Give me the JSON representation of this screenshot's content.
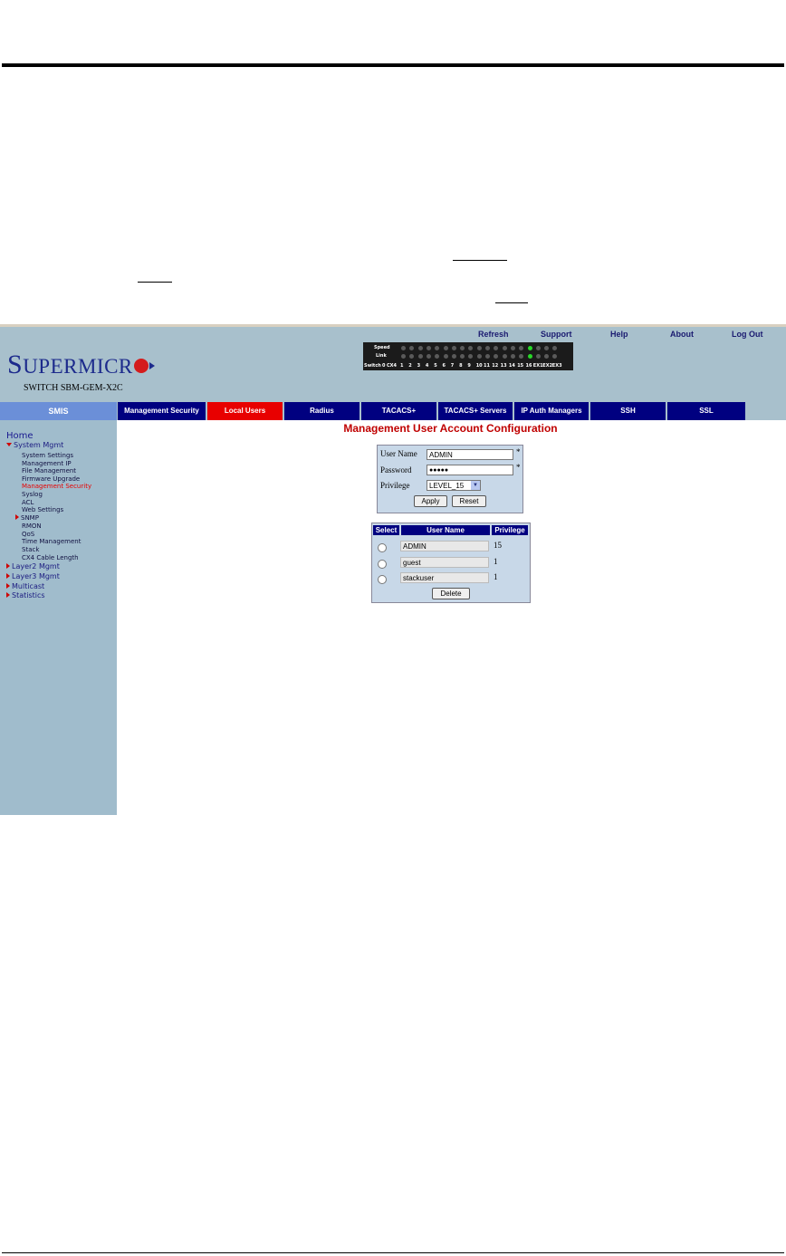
{
  "header": {
    "links": [
      "Refresh",
      "Support",
      "Help",
      "About",
      "Log Out"
    ],
    "logo": {
      "S": "S",
      "rest": "UPERMICR"
    },
    "switch_name": "SWITCH SBM-GEM-X2C"
  },
  "port_panel": {
    "row_speed": "Speed",
    "row_link": "Link",
    "labels": [
      "Switch",
      "0",
      "CX4",
      "1",
      "2",
      "3",
      "4",
      "5",
      "6",
      "7",
      "8",
      "9",
      "10",
      "11",
      "12",
      "13",
      "14",
      "15",
      "16",
      "EX1",
      "EX2",
      "EX3"
    ],
    "active_port": "16",
    "active_color": "#28d828"
  },
  "nav": {
    "smis": "SMIS",
    "tabs": [
      "Management Security",
      "Local Users",
      "Radius",
      "TACACS+",
      "TACACS+ Servers",
      "IP Auth Managers",
      "SSH",
      "SSL"
    ],
    "active_tab": "Local Users"
  },
  "sidebar": {
    "home": "Home",
    "system_mgmt": "System Mgmt",
    "system_items": [
      "System Settings",
      "Management IP",
      "File Management",
      "Firmware Upgrade",
      "Management Security",
      "Syslog",
      "ACL",
      "Web Settings",
      "SNMP",
      "RMON",
      "QoS",
      "Time Management",
      "Stack",
      "CX4 Cable Length"
    ],
    "active_item": "Management Security",
    "groups": [
      "Layer2 Mgmt",
      "Layer3 Mgmt",
      "Multicast",
      "Statistics"
    ]
  },
  "main": {
    "title": "Management User Account Configuration",
    "form": {
      "username_label": "User Name",
      "username_value": "ADMIN",
      "password_label": "Password",
      "password_value": "●●●●●",
      "privilege_label": "Privilege",
      "privilege_value": "LEVEL_15",
      "required_mark": "*",
      "apply_label": "Apply",
      "reset_label": "Reset"
    },
    "table": {
      "headers": [
        "Select",
        "User Name",
        "Privilege"
      ],
      "rows": [
        {
          "name": "ADMIN",
          "privilege": "15"
        },
        {
          "name": "guest",
          "privilege": "1"
        },
        {
          "name": "stackuser",
          "privilege": "1"
        }
      ],
      "delete_label": "Delete"
    }
  },
  "colors": {
    "nav_tab": "#000080",
    "active_tab": "#e80000",
    "title": "#c00000",
    "sidebar_bg": "#a0bccc"
  }
}
